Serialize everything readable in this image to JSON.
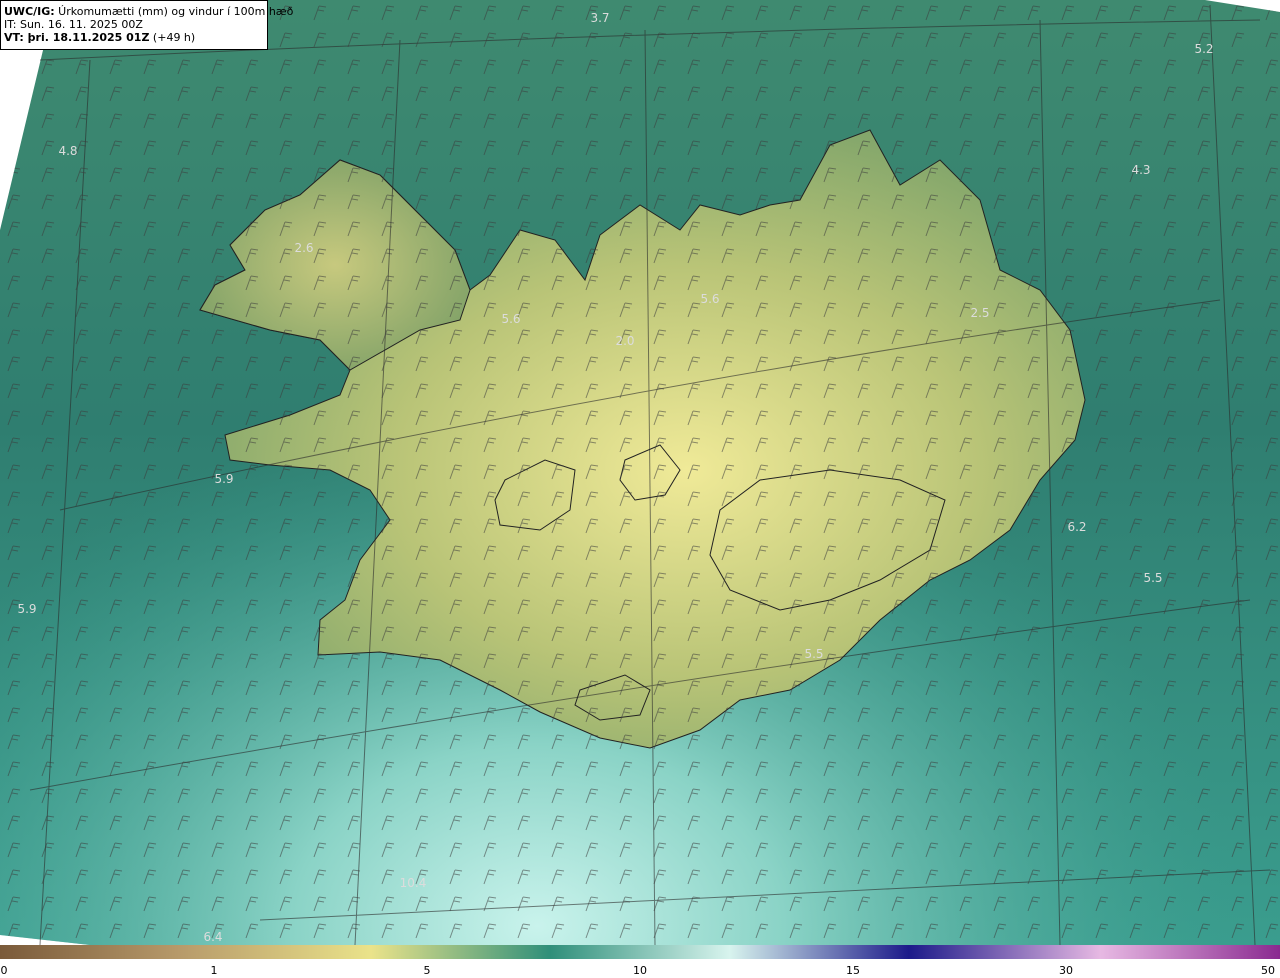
{
  "header": {
    "line1_bold": "UWC/IG:",
    "line1_rest": " Úrkomumætti (mm) og vindur í 100m hæð",
    "line2": "IT: Sun. 16. 11. 2025 00Z",
    "line3_bold": "VT: þri. 18.11.2025 01Z",
    "line3_rest": " (+49 h)"
  },
  "map_labels": [
    "3.7",
    "5.2",
    "4.8",
    "4.3",
    "2.6",
    "5.6",
    "5.6",
    "2.5",
    "2.0",
    "5.9",
    "6.2",
    "5.5",
    "5.9",
    "5.5",
    "10.4",
    "6.4"
  ],
  "colorbar": {
    "ticks": [
      "0",
      "1",
      "5",
      "10",
      "15",
      "30",
      "50"
    ],
    "colors": [
      "#7a5a3a",
      "#b79a6a",
      "#eae38a",
      "#2f8f7a",
      "#d8f4ee",
      "#1c1a8a",
      "#e7b9e3",
      "#8a2a90"
    ]
  }
}
